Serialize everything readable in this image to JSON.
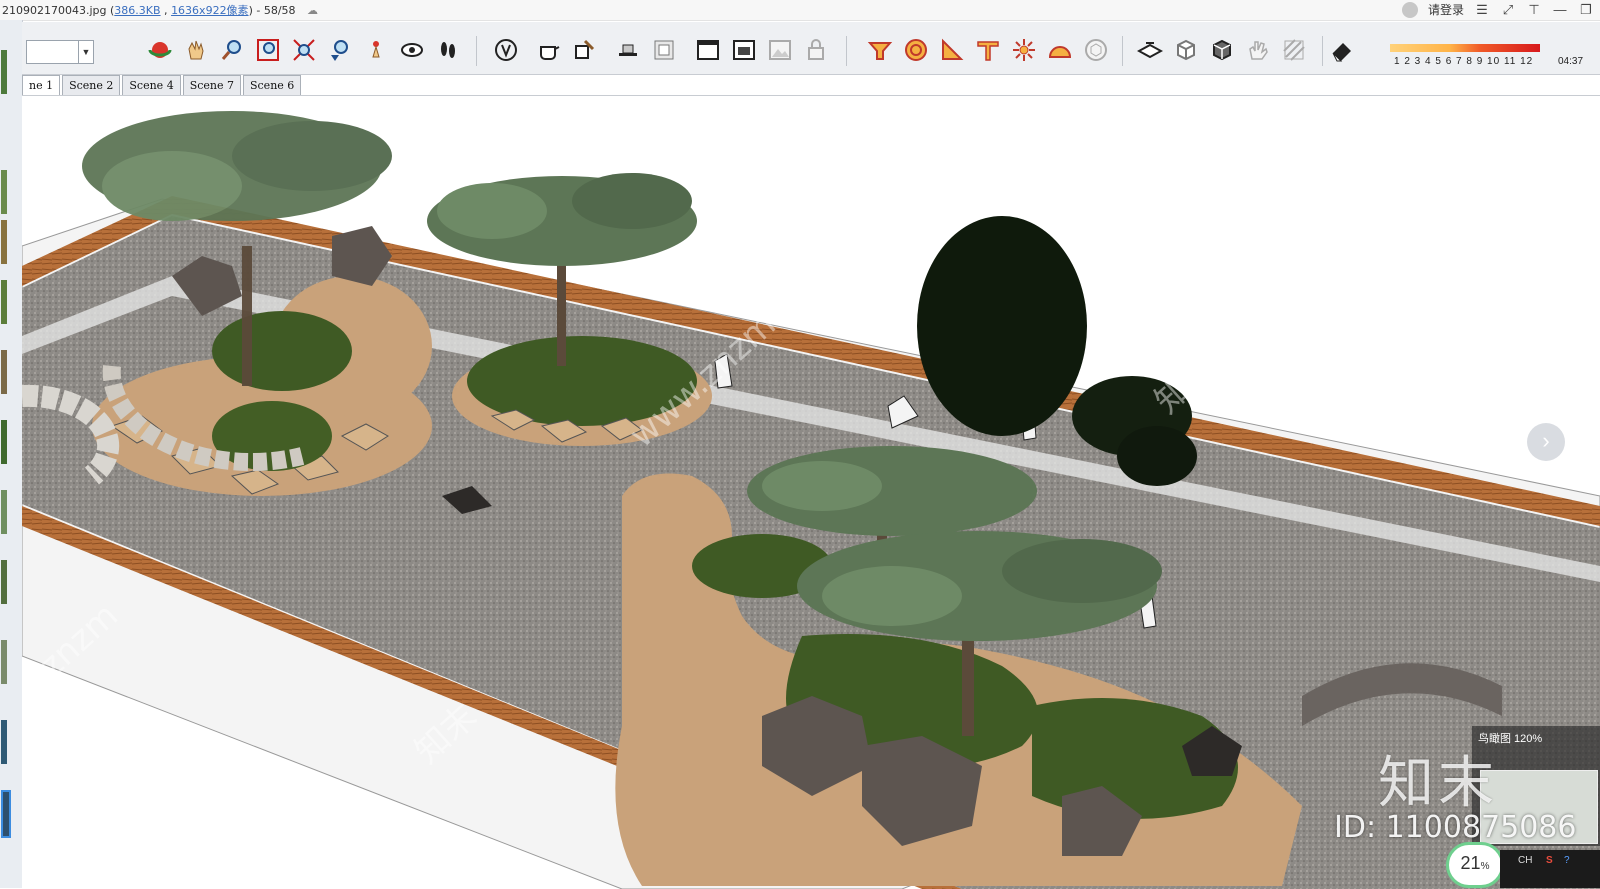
{
  "window": {
    "filename": "210902170043.jpg (",
    "filesize": "386.3KB",
    "sep": " , ",
    "dimensions": "1636x922像素",
    "tail": ") - 58/58",
    "login": "请登录"
  },
  "toolbar": {
    "scale_numbers": "1 2 3 4 5 6 7 8 9 10 11 12",
    "time": "04:37",
    "tools": [
      "orbit",
      "pan",
      "zoom",
      "zoom-window",
      "zoom-extents",
      "previous-view",
      "position-camera",
      "look-around",
      "walk",
      "style-xray",
      "teapot-material",
      "hand-paint",
      "flat-shade",
      "section-box",
      "window-frame",
      "window-photo",
      "image-faded",
      "lock",
      "sandbox-from-contours",
      "circle-target",
      "triangle-ruler",
      "tee-square",
      "sunburst",
      "half-dome",
      "sphere-cube",
      "mesh-plane",
      "box-outline",
      "box-solid",
      "hand-grab",
      "hatch-grid",
      "eraser"
    ]
  },
  "tabs": [
    {
      "label": "ne 1",
      "active": true
    },
    {
      "label": "Scene 2",
      "active": false
    },
    {
      "label": "Scene 4",
      "active": false
    },
    {
      "label": "Scene 7",
      "active": false
    },
    {
      "label": "Scene 6",
      "active": false
    }
  ],
  "overlay": {
    "minimap_label": "鸟瞰图 120%",
    "watermark_text": "知末",
    "watermark_id": "ID: 1100875086",
    "zoom": "21",
    "zoom_unit": "%",
    "tray_lang": "CH"
  },
  "diagonal_watermarks": [
    "www.znzmo.com",
    "知末网 www.znzmo.com",
    "知末",
    "znzm"
  ],
  "colors": {
    "gravel": "#8d8a86",
    "border_wood": "#b8703a",
    "lawn": "#3f5a24",
    "stone": "#c9a27a",
    "rock": "#5d5550"
  }
}
